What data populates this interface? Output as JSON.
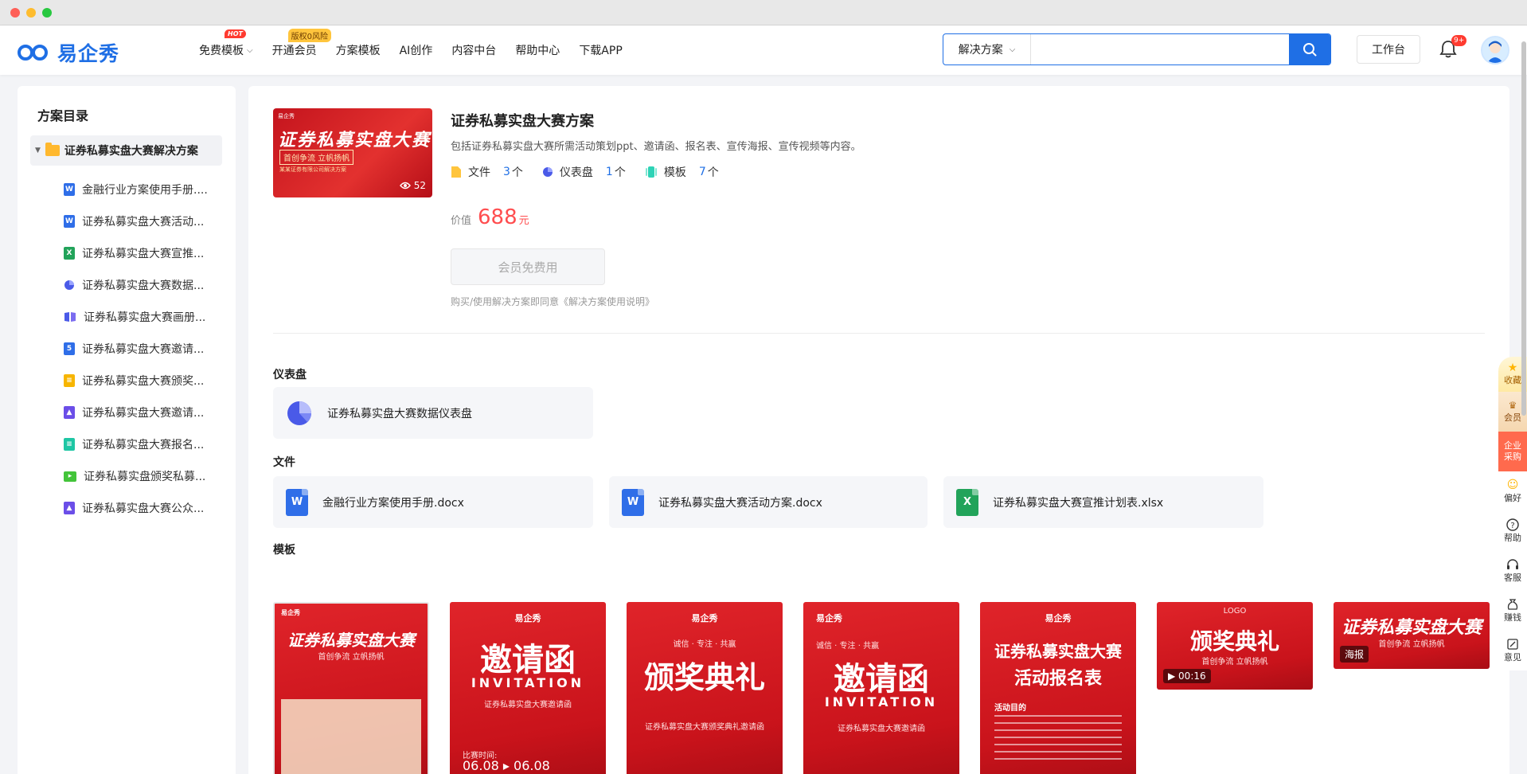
{
  "nav": {
    "logo_text": "易企秀",
    "items": [
      {
        "label": "免费模板",
        "badge": "HOT",
        "dropdown": true
      },
      {
        "label": "开通会员",
        "badge": "版权0风险"
      },
      {
        "label": "方案模板"
      },
      {
        "label": "AI创作"
      },
      {
        "label": "内容中台"
      },
      {
        "label": "帮助中心"
      },
      {
        "label": "下载APP"
      }
    ],
    "search_scope": "解决方案",
    "search_placeholder": "",
    "workbench": "工作台",
    "notification_count": "9+"
  },
  "sidebar": {
    "title": "方案目录",
    "root": "证券私募实盘大赛解决方案",
    "items": [
      {
        "label": "金融行业方案使用手册....",
        "icon": "word-icon",
        "color": "#2f6ee8"
      },
      {
        "label": "证券私募实盘大赛活动...",
        "icon": "word-icon",
        "color": "#2f6ee8"
      },
      {
        "label": "证券私募实盘大赛宣推...",
        "icon": "excel-icon",
        "color": "#22a35a"
      },
      {
        "label": "证券私募实盘大赛数据...",
        "icon": "dashboard-icon",
        "color": "#4a5ae8"
      },
      {
        "label": "证券私募实盘大赛画册...",
        "icon": "album-icon",
        "color": "#4a5ae8"
      },
      {
        "label": "证券私募实盘大赛邀请...",
        "icon": "h5-icon",
        "color": "#2f6ee8"
      },
      {
        "label": "证券私募实盘大赛颁奖...",
        "icon": "doc-icon",
        "color": "#f7b500"
      },
      {
        "label": "证券私募实盘大赛邀请...",
        "icon": "image-icon",
        "color": "#6b4ee8"
      },
      {
        "label": "证券私募实盘大赛报名...",
        "icon": "form-icon",
        "color": "#1ec6a4"
      },
      {
        "label": "证券私募实盘颁奖私募...",
        "icon": "video-icon",
        "color": "#43c43a"
      },
      {
        "label": "证券私募实盘大赛公众...",
        "icon": "image-icon",
        "color": "#6b4ee8"
      }
    ]
  },
  "solution": {
    "cover_brand": "易企秀",
    "cover_title": "证券私募实盘大赛",
    "cover_sub": "首创争流 立帆扬帆",
    "cover_foot": "某某证券有限公司解决方案",
    "views": "52",
    "title": "证券私募实盘大赛方案",
    "desc": "包括证券私募实盘大赛所需活动策划ppt、邀请函、报名表、宣传海报、宣传视频等内容。",
    "stats": [
      {
        "label": "文件",
        "count": "3",
        "unit": "个"
      },
      {
        "label": "仪表盘",
        "count": "1",
        "unit": "个"
      },
      {
        "label": "模板",
        "count": "7",
        "unit": "个"
      }
    ],
    "price_label": "价值",
    "price": "688",
    "price_unit": "元",
    "free_button": "会员免费用",
    "agreement": "购买/使用解决方案即同意《解决方案使用说明》"
  },
  "dashboard_section": {
    "title": "仪表盘",
    "items": [
      "证券私募实盘大赛数据仪表盘"
    ]
  },
  "files_section": {
    "title": "文件",
    "items": [
      {
        "name": "金融行业方案使用手册.docx",
        "type": "W",
        "color": "#2f6ee8"
      },
      {
        "name": "证券私募实盘大赛活动方案.docx",
        "type": "W",
        "color": "#2f6ee8"
      },
      {
        "name": "证券私募实盘大赛宣推计划表.xlsx",
        "type": "X",
        "color": "#22a35a"
      }
    ]
  },
  "templates_section": {
    "title": "模板",
    "items": [
      {
        "title": "证券私募实盘大赛",
        "sub": "首创争流 立帆扬帆",
        "logo": "易企秀"
      },
      {
        "title": "邀请函",
        "sub": "INVITATION",
        "extra": "证券私募实盘大赛邀请函",
        "date": "06.08 ▸ 06.08",
        "date_label": "比赛时间:"
      },
      {
        "title": "颁奖典礼",
        "sub": "诚信 · 专注 · 共赢",
        "extra": "证券私募实盘大赛颁奖典礼邀请函"
      },
      {
        "title": "邀请函",
        "sub": "INVITATION",
        "extra": "证券私募实盘大赛邀请函",
        "top": "诚信 · 专注 · 共赢"
      },
      {
        "title": "证券私募实盘大赛",
        "sub": "活动报名表",
        "extra": "活动目的"
      },
      {
        "title": "颁奖典礼",
        "sub": "首创争流 立帆扬帆",
        "top": "LOGO",
        "duration": "00:16"
      },
      {
        "title": "证券私募实盘大赛",
        "sub": "首创争流 立帆扬帆",
        "tag": "海报"
      }
    ]
  },
  "right_toolbar": [
    "收藏",
    "会员",
    "企业采购",
    "偏好",
    "帮助",
    "客服",
    "赚钱",
    "意见"
  ],
  "colors": {
    "brand": "#1f6fe5",
    "price": "#ff4d4f",
    "red": "#d9161f"
  }
}
